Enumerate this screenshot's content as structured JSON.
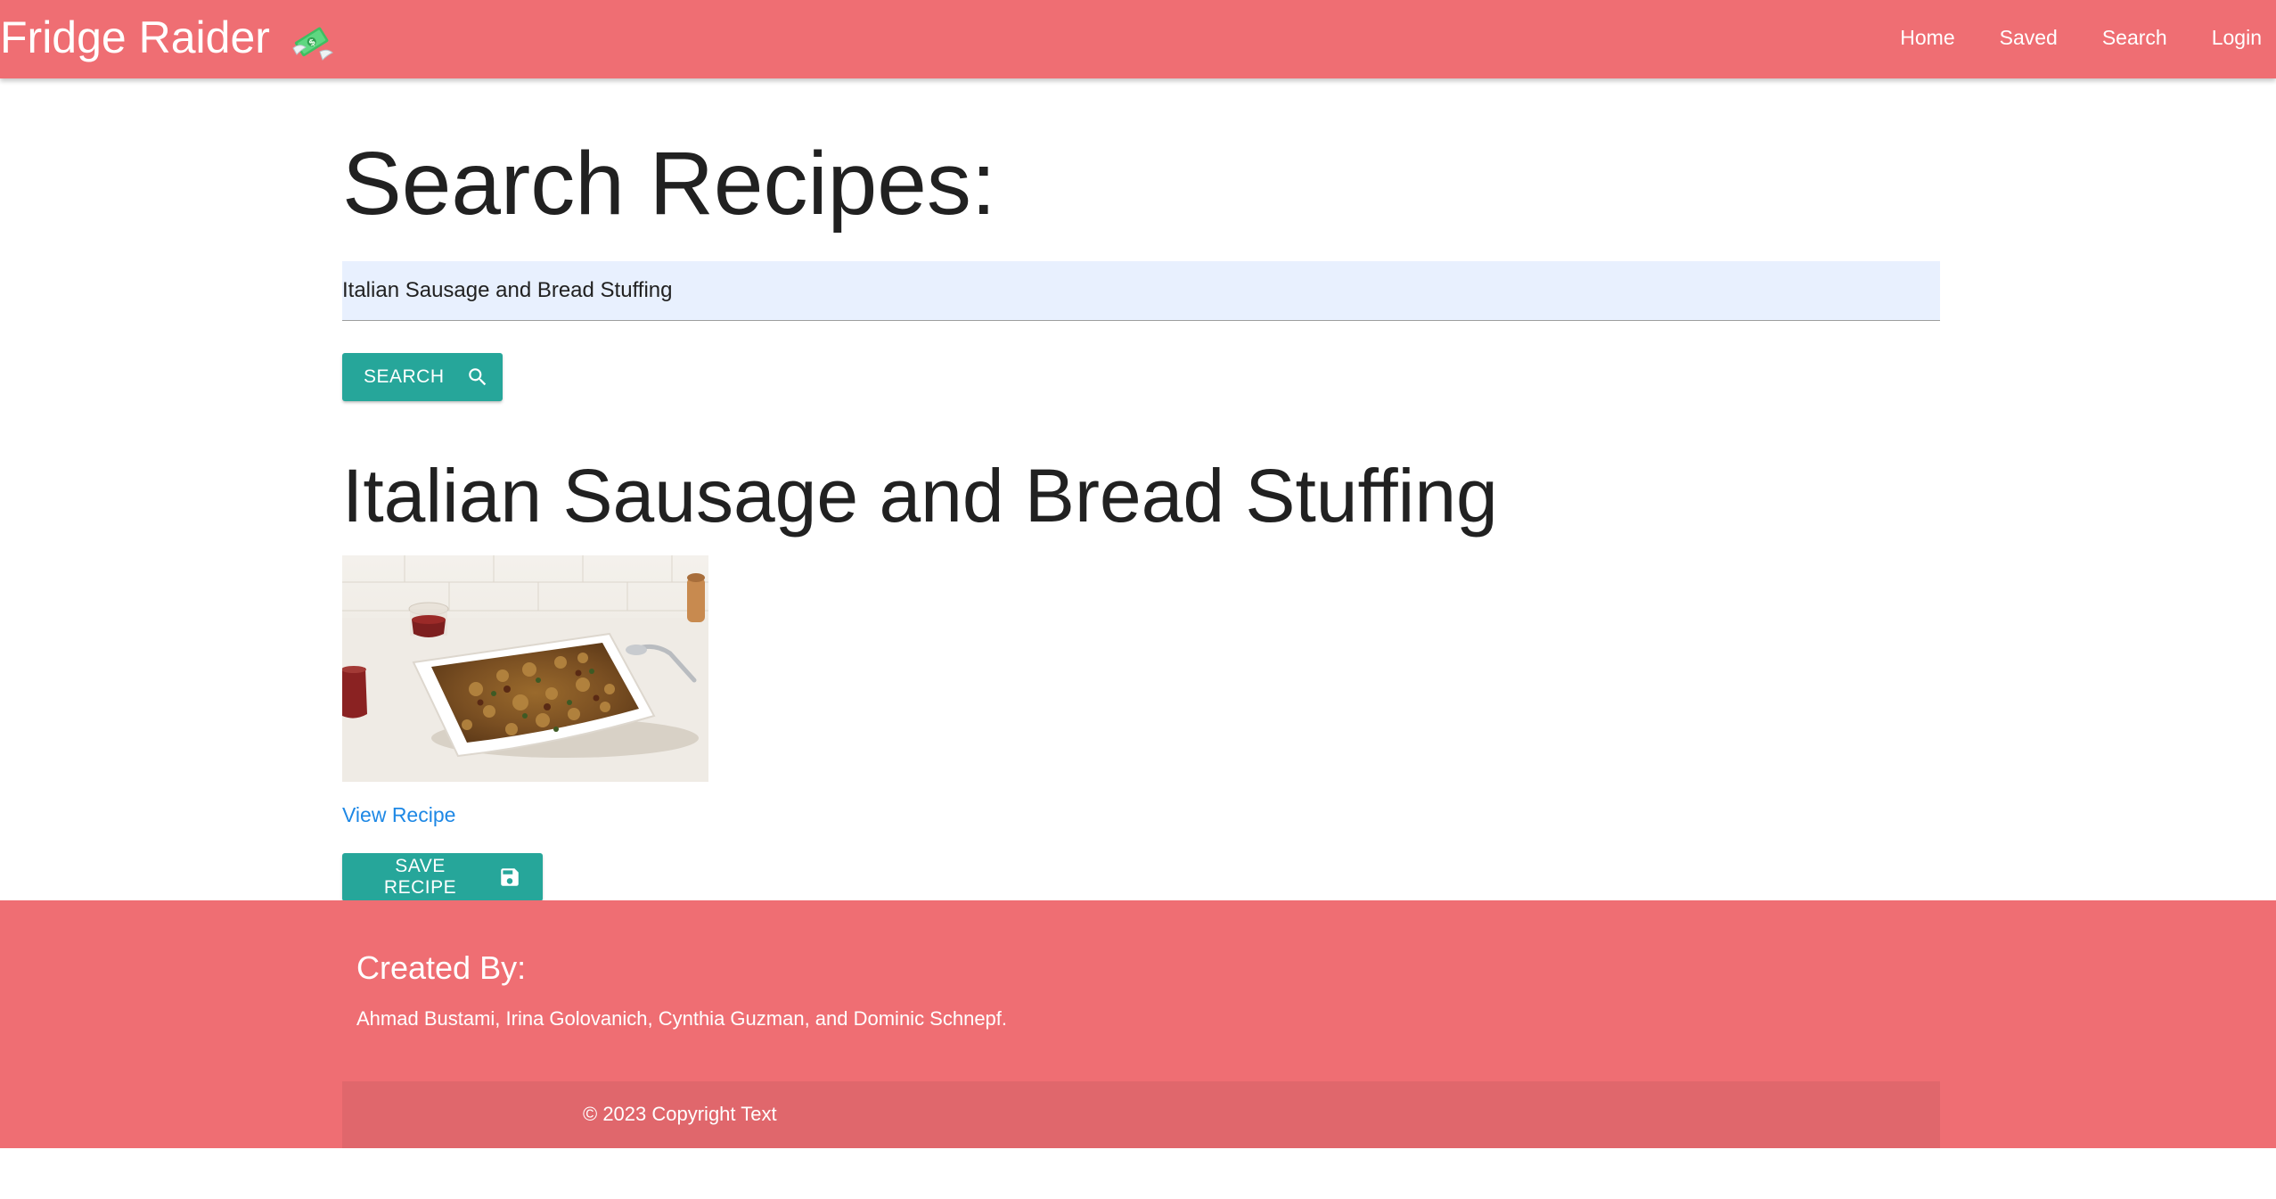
{
  "navbar": {
    "brand": "Fridge Raider",
    "brand_icon": "money-with-wings-icon",
    "links": [
      "Home",
      "Saved",
      "Search",
      "Login"
    ]
  },
  "main": {
    "title": "Search Recipes:",
    "search": {
      "value": "Italian Sausage and Bread Stuffing",
      "button_label": "Search",
      "button_icon": "search-icon"
    },
    "result": {
      "title": "Italian Sausage and Bread Stuffing",
      "link_label": "View Recipe",
      "save_label": "Save Recipe",
      "save_icon": "floppy-disk-icon"
    }
  },
  "footer": {
    "heading": "Created By:",
    "authors": "Ahmad Bustami, Irina Golovanich, Cynthia Guzman, and Dominic Schnepf.",
    "copyright": "© 2023 Copyright Text"
  },
  "colors": {
    "primary": "#ef6e73",
    "button": "#26a69a",
    "link": "#1e88e5",
    "input_bg": "#e8f0fe"
  }
}
